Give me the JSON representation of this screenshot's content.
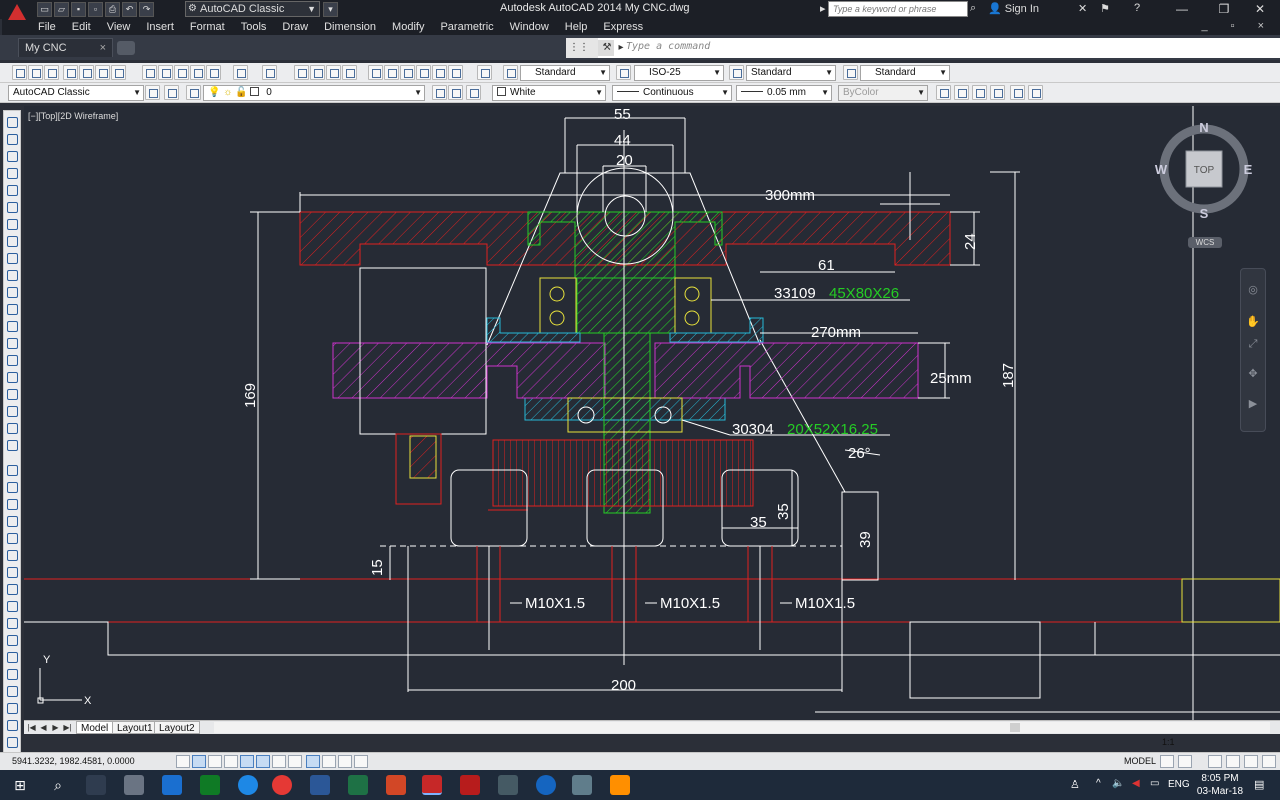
{
  "title_bar": {
    "title": "Autodesk AutoCAD 2014    My CNC.dwg",
    "workspace": "AutoCAD Classic",
    "search_placeholder": "Type a keyword or phrase",
    "signin": "Sign In"
  },
  "menu": [
    "File",
    "Edit",
    "View",
    "Insert",
    "Format",
    "Tools",
    "Draw",
    "Dimension",
    "Modify",
    "Parametric",
    "Window",
    "Help",
    "Express"
  ],
  "file_tab": {
    "label": "My CNC"
  },
  "command_line": {
    "placeholder": "Type a command"
  },
  "toolbar_styles": {
    "text_style": "Standard",
    "dim_style": "ISO-25",
    "table_style": "Standard",
    "multileader_style": "Standard"
  },
  "toolbar_props": {
    "workspace": "AutoCAD Classic",
    "layer": "0",
    "color": "White",
    "linetype": "Continuous",
    "lineweight": "0.05 mm",
    "plotstyle": "ByColor"
  },
  "viewport": {
    "label": "[−][Top][2D Wireframe]",
    "viewcube": {
      "n": "N",
      "s": "S",
      "e": "E",
      "w": "W",
      "top": "TOP",
      "wcs": "WCS"
    },
    "ucs": {
      "x": "X",
      "y": "Y"
    }
  },
  "dimensions": {
    "d55": "55",
    "d44": "44",
    "d20": "20",
    "d300": "300mm",
    "d24": "24",
    "d61": "61",
    "bearing1_code": "33109",
    "bearing1_size": "45X80X26",
    "d270": "270mm",
    "d25": "25mm",
    "d169": "169",
    "d187": "187",
    "bearing2_code": "30304",
    "bearing2_size": "20X52X16.25",
    "angle": "26°",
    "d35h": "35",
    "d35v": "35",
    "d39": "39",
    "d15": "15",
    "bolt1": "M10X1.5",
    "bolt2": "M10X1.5",
    "bolt3": "M10X1.5",
    "d200": "200"
  },
  "layout_tabs": [
    "Model",
    "Layout1",
    "Layout2"
  ],
  "status": {
    "coords": "5941.3232, 1982.4581, 0.0000",
    "model": "MODEL",
    "scale": "1:1"
  },
  "taskbar": {
    "time": "8:05 PM",
    "date": "03-Mar-18",
    "lang": "ENG"
  },
  "colors": {
    "viewport_bg": "#262b35",
    "red": "#e02020",
    "green": "#25cc25",
    "magenta": "#cc33cc",
    "cyan": "#27b8d6",
    "yellow": "#e8e23c"
  }
}
